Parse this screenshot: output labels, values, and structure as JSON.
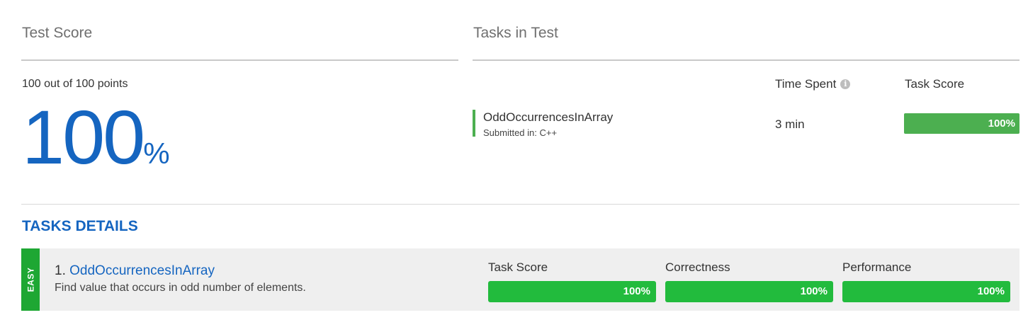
{
  "test_score": {
    "title": "Test Score",
    "points_line": "100 out of 100 points",
    "percent_value": "100",
    "percent_sign": "%"
  },
  "tasks_in_test": {
    "title": "Tasks in Test",
    "time_spent_header": "Time Spent",
    "task_score_header": "Task Score",
    "info_icon_glyph": "i",
    "tasks": [
      {
        "name": "OddOccurrencesInArray",
        "submitted": "Submitted in: C++",
        "time_spent": "3 min",
        "score_label": "100%",
        "score_fraction": 1.0
      }
    ]
  },
  "tasks_details": {
    "title": "TASKS DETAILS",
    "items": [
      {
        "difficulty": "EASY",
        "number": "1.",
        "name": "OddOccurrencesInArray",
        "description": "Find value that occurs in odd number of elements.",
        "metrics": [
          {
            "label": "Task Score",
            "value": "100%",
            "fraction": 1.0
          },
          {
            "label": "Correctness",
            "value": "100%",
            "fraction": 1.0
          },
          {
            "label": "Performance",
            "value": "100%",
            "fraction": 1.0
          }
        ]
      }
    ]
  },
  "colors": {
    "accent_blue": "#1565c0",
    "score_green": "#4caf50",
    "metric_green": "#22bb3d",
    "easy_green": "#1ea733"
  }
}
